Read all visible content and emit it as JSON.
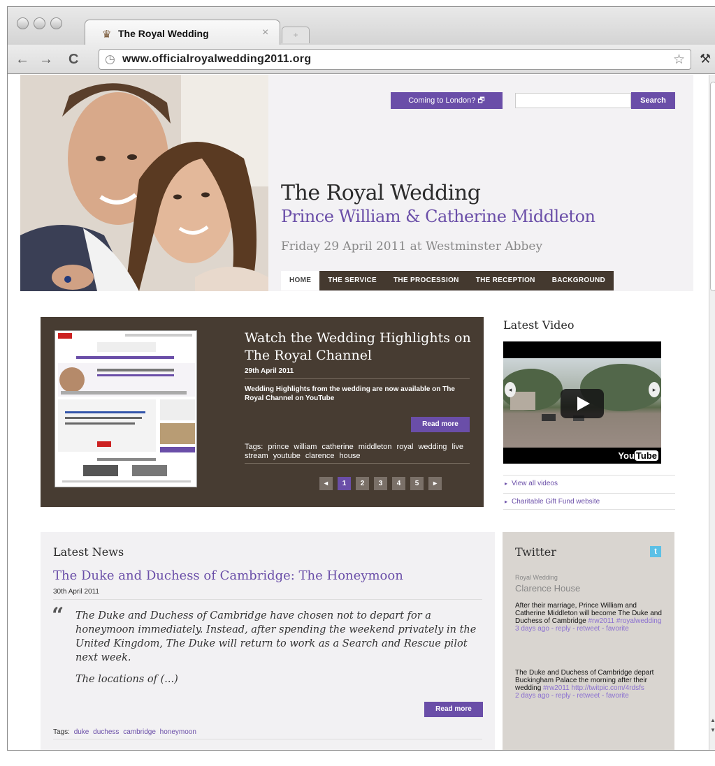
{
  "browser": {
    "tab_title": "The Royal Wedding",
    "tab_close": "×",
    "url": "www.officialroyalwedding2011.org",
    "back": "←",
    "forward": "→",
    "reload": "C",
    "star": "☆",
    "wrench": "🔧"
  },
  "header": {
    "coming_to_london": "Coming to London? 🗗",
    "search_placeholder": "",
    "search_label": "Search",
    "title": "The Royal Wedding",
    "subtitle": "Prince William & Catherine Middleton",
    "date_line": "Friday 29 April 2011 at Westminster Abbey",
    "nav": [
      {
        "label": "HOME",
        "active": true
      },
      {
        "label": "THE SERVICE",
        "active": false
      },
      {
        "label": "THE PROCESSION",
        "active": false
      },
      {
        "label": "THE RECEPTION",
        "active": false
      },
      {
        "label": "BACKGROUND",
        "active": false
      }
    ]
  },
  "feature": {
    "title": "Watch the Wedding Highlights on The Royal Channel",
    "date": "29th April 2011",
    "description": "Wedding Highlights from the wedding are now available on The Royal Channel on YouTube",
    "read_more": "Read more",
    "tags_label": "Tags:",
    "tags": [
      "prince",
      "william",
      "catherine",
      "middleton",
      "royal",
      "wedding",
      "live",
      "stream",
      "youtube",
      "clarence",
      "house"
    ],
    "pager": [
      "◂",
      "1",
      "2",
      "3",
      "4",
      "5",
      "▸"
    ],
    "pager_active": "1"
  },
  "video": {
    "heading": "Latest Video",
    "youtube_you": "You",
    "youtube_tube": "Tube",
    "links": [
      "View all videos",
      "Charitable Gift Fund website"
    ]
  },
  "news": {
    "heading": "Latest News",
    "title": "The Duke and Duchess of Cambridge: The Honeymoon",
    "date": "30th April 2011",
    "quote_mark": "“",
    "body": "The Duke and Duchess of Cambridge have chosen not to depart for a honeymoon immediately.  Instead, after spending the weekend privately in the United Kingdom, The Duke will return to work as a Search and Rescue pilot next week.",
    "more": "The locations of (...)",
    "read_more": "Read more",
    "tags_label": "Tags:",
    "tags": [
      "duke",
      "duchess",
      "cambridge",
      "honeymoon"
    ]
  },
  "twitter": {
    "heading": "Twitter",
    "bird": "t",
    "account_line1": "Royal Wedding",
    "account_line2": "Clarence House",
    "tweets": [
      {
        "text": "After their marriage, Prince William and Catherine Middleton will become The Duke and Duchess of Cambridge",
        "hashtags": "#rw2011 #royalwedding",
        "meta": "3 days ago - reply - retweet - favorite"
      },
      {
        "text": "The Duke and Duchess of Cambridge depart Buckingham Palace the morning after their wedding",
        "hashtags": "#rw2011 http://twitpic.com/4rdsfs",
        "meta": "2 days ago - reply - retweet - favorite"
      }
    ]
  },
  "colors": {
    "accent_purple": "#6a4ea8",
    "nav_brown": "#44392f",
    "feature_brown": "#473c32"
  }
}
